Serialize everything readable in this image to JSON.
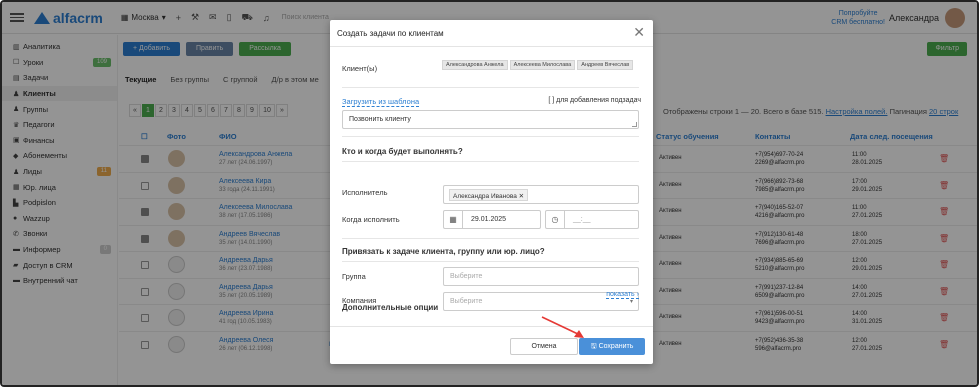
{
  "topbar": {
    "brand": "alfacrm",
    "branch": "Москва",
    "search_placeholder": "Поиск клиента",
    "promo_line1": "Попробуйте",
    "promo_line2": "CRM бесплатно!",
    "user_name": "Александра"
  },
  "sidebar": {
    "items": [
      {
        "label": "Аналитика",
        "icon": "chart-icon"
      },
      {
        "label": "Уроки",
        "icon": "calendar-icon",
        "badge": "109",
        "badge_color": "#6cbf6c"
      },
      {
        "label": "Задачи",
        "icon": "tasks-icon"
      },
      {
        "label": "Клиенты",
        "icon": "user-icon",
        "active": true
      },
      {
        "label": "Группы",
        "icon": "users-icon"
      },
      {
        "label": "Педагоги",
        "icon": "graduation-icon"
      },
      {
        "label": "Финансы",
        "icon": "money-icon"
      },
      {
        "label": "Абонементы",
        "icon": "ticket-icon"
      },
      {
        "label": "Лиды",
        "icon": "leads-icon",
        "badge": "11",
        "badge_color": "#f0ad4e"
      },
      {
        "label": "Юр. лица",
        "icon": "building-icon"
      },
      {
        "label": "Podpislon",
        "icon": "doc-icon"
      },
      {
        "label": "Wazzup",
        "icon": "chat-icon"
      },
      {
        "label": "Звонки",
        "icon": "phone-icon"
      },
      {
        "label": "Информер",
        "icon": "info-icon",
        "badge": "0",
        "badge_color": "#cfcfcf"
      },
      {
        "label": "Доступ в CRM",
        "icon": "lock-icon"
      },
      {
        "label": "Внутренний чат",
        "icon": "message-icon"
      }
    ]
  },
  "toolbar": {
    "add": "+ Добавить",
    "edit": "Править",
    "mailing": "Рассылка",
    "filter": "Фильтр"
  },
  "tabs": [
    "Текущие",
    "Без группы",
    "С группой",
    "Д/р в этом ме"
  ],
  "pager": [
    "«",
    "1",
    "2",
    "3",
    "4",
    "5",
    "6",
    "7",
    "8",
    "9",
    "10",
    "»"
  ],
  "rows_info": {
    "text": "Отображены строки 1 — 20. Всего в базе 515.",
    "settings_link": "Настройка полей.",
    "pagination_label": "Пагинация",
    "pagination_link": "20 строк"
  },
  "table": {
    "headers": {
      "photo": "Фото",
      "fio": "ФИО",
      "status": "Статус обучения",
      "contacts": "Контакты",
      "next_visit": "Дата след. посещения"
    },
    "rows": [
      {
        "name": "Александрова Анжела",
        "dob": "27 лет (24.06.1997)",
        "checked": true,
        "status": "Активен",
        "phone": "+7(954)697-70-24",
        "email": "2269@alfacrm.pro",
        "time": "11:00",
        "date": "28.01.2025",
        "photo": true
      },
      {
        "name": "Алексеева Кира",
        "dob": "33 года (24.11.1991)",
        "checked": false,
        "status": "Активен",
        "phone": "+7(966)892-73-68",
        "email": "7985@alfacrm.pro",
        "time": "17:00",
        "date": "29.01.2025",
        "photo": true
      },
      {
        "name": "Алексеева Милослава",
        "dob": "38 лет (17.05.1986)",
        "checked": true,
        "status": "Активен",
        "phone": "+7(940)165-52-07",
        "email": "4216@alfacrm.pro",
        "time": "11:00",
        "date": "27.01.2025",
        "photo": true
      },
      {
        "name": "Андреев Вячеслав",
        "dob": "35 лет (14.01.1990)",
        "checked": true,
        "status": "Активен",
        "phone": "+7(912)130-61-48",
        "email": "7696@alfacrm.pro",
        "time": "18:00",
        "date": "27.01.2025",
        "photo": true
      },
      {
        "name": "Андреева Дарья",
        "dob": "36 лет (23.07.1988)",
        "checked": false,
        "status": "Активен",
        "phone": "+7(934)885-65-69",
        "email": "5210@alfacrm.pro",
        "time": "12:00",
        "date": "29.01.2025",
        "photo": false
      },
      {
        "name": "Андреева Дарья",
        "dob": "35 лет (20.05.1989)",
        "checked": false,
        "status": "Активен",
        "phone": "+7(991)237-12-84",
        "email": "6509@alfacrm.pro",
        "time": "14:00",
        "date": "27.01.2025",
        "photo": false
      },
      {
        "name": "Андреева Ирина",
        "dob": "41 год (10.05.1983)",
        "checked": false,
        "status": "Активен",
        "phone": "+7(961)596-00-51",
        "email": "9423@alfacrm.pro",
        "time": "14:00",
        "date": "31.01.2025",
        "photo": false
      },
      {
        "name": "Андреева Олеся",
        "dob": "26 лет (06.12.1998)",
        "checked": false,
        "status": "Активен",
        "phone": "+7(952)436-35-38",
        "email": "596@alfacrm.pro",
        "time": "12:00",
        "date": "27.01.2025",
        "photo": false,
        "group1": "Группа 22",
        "group2": "Группа 22",
        "payment": "2 900,00 / -6 уроков"
      }
    ]
  },
  "modal": {
    "title": "Создать задачи по клиентам",
    "clients_label": "Клиент(ы)",
    "clients": [
      "Александрова Анжела",
      "Алексеева Милослава",
      "Андреев Вячеслав"
    ],
    "template_link": "Загрузить из шаблона",
    "template_note": "[ ] для добавления подзадач",
    "task_text": "Позвонить клиенту",
    "who_when_title": "Кто и когда будет выполнять?",
    "executor_label": "Исполнитель",
    "executor_value": "Александра Иванова",
    "when_label": "Когда исполнить",
    "date_value": "29.01.2025",
    "time_placeholder": "__:__",
    "bind_title": "Привязать к задаче клиента, группу или юр. лицо?",
    "group_label": "Группа",
    "group_placeholder": "Выберите",
    "company_label": "Компания",
    "company_placeholder": "Выберите",
    "extra_title": "Дополнительные опции",
    "show_link": "показать",
    "cancel": "Отмена",
    "save": "Сохранить"
  },
  "colors": {
    "accent": "#2c7fd2",
    "green": "#4caf50",
    "arrow": "#e53935"
  }
}
